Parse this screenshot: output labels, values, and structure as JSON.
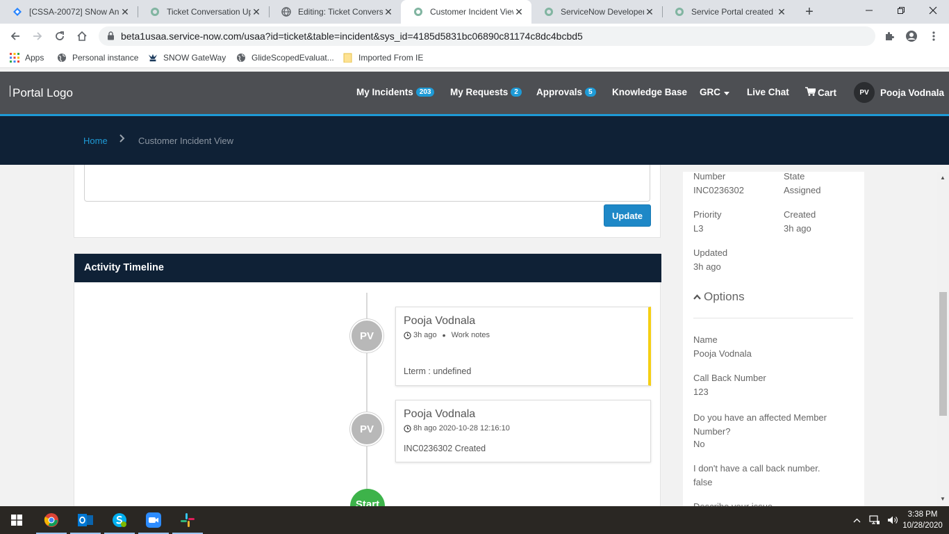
{
  "browser": {
    "tabs": [
      {
        "title": "[CSSA-20072] SNow An",
        "icon": "jira-icon"
      },
      {
        "title": "Ticket Conversation Up",
        "icon": "servicenow-icon"
      },
      {
        "title": "Editing: Ticket Conversa",
        "icon": "globe-icon"
      },
      {
        "title": "Customer Incident View",
        "icon": "servicenow-icon",
        "active": true
      },
      {
        "title": "ServiceNow Developers",
        "icon": "servicenow-icon"
      },
      {
        "title": "Service Portal created t",
        "icon": "servicenow-icon"
      }
    ],
    "url": "beta1usaa.service-now.com/usaa?id=ticket&table=incident&sys_id=4185d5831bc06890c81174c8dc4bcbd5",
    "bookmarks": [
      {
        "label": "Apps"
      },
      {
        "label": "Personal instance"
      },
      {
        "label": "SNOW GateWay"
      },
      {
        "label": "GlideScopedEvaluat..."
      },
      {
        "label": "Imported From IE"
      }
    ]
  },
  "header": {
    "logo_alt": "Portal Logo",
    "nav": {
      "my_incidents": {
        "label": "My Incidents",
        "count": "203"
      },
      "my_requests": {
        "label": "My Requests",
        "count": "2"
      },
      "approvals": {
        "label": "Approvals",
        "count": "5"
      },
      "knowledge_base": {
        "label": "Knowledge Base"
      },
      "grc": {
        "label": "GRC"
      },
      "live_chat": {
        "label": "Live Chat"
      },
      "cart": {
        "label": "Cart"
      }
    },
    "user": {
      "initials": "PV",
      "name": "Pooja Vodnala"
    }
  },
  "breadcrumb": {
    "home": "Home",
    "current": "Customer Incident View"
  },
  "update_button": "Update",
  "timeline": {
    "title": "Activity Timeline",
    "entries": [
      {
        "initials": "PV",
        "author": "Pooja Vodnala",
        "time": "3h ago",
        "type": "Work notes",
        "text": "Lterm : undefined"
      },
      {
        "initials": "PV",
        "author": "Pooja Vodnala",
        "time": "8h ago 2020-10-28 12:16:10",
        "text": "INC0236302 Created"
      }
    ],
    "start_label": "Start"
  },
  "details": {
    "number_label": "Number",
    "number": "INC0236302",
    "state_label": "State",
    "state": "Assigned",
    "priority_label": "Priority",
    "priority": "L3",
    "created_label": "Created",
    "created": "3h ago",
    "updated_label": "Updated",
    "updated": "3h ago"
  },
  "options": {
    "title": "Options",
    "fields": [
      {
        "label": "Name",
        "value": "Pooja Vodnala"
      },
      {
        "label": "Call Back Number",
        "value": "123"
      },
      {
        "label": "Do you have an affected Member Number?",
        "value": "No"
      },
      {
        "label": "I don't have a call back number.",
        "value": "false"
      },
      {
        "label": "Describe your issue"
      }
    ]
  },
  "taskbar": {
    "time": "3:38 PM",
    "date": "10/28/2020"
  }
}
